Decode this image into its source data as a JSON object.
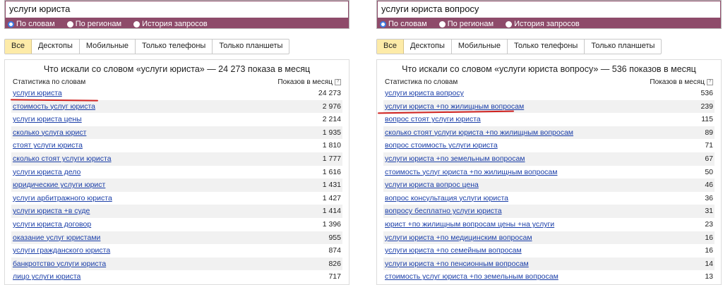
{
  "left": {
    "query": "услуги юриста",
    "radios": [
      {
        "label": "По словам",
        "checked": true
      },
      {
        "label": "По регионам",
        "checked": false
      },
      {
        "label": "История запросов",
        "checked": false
      }
    ],
    "tabs": [
      {
        "label": "Все",
        "active": true
      },
      {
        "label": "Десктопы",
        "active": false
      },
      {
        "label": "Мобильные",
        "active": false
      },
      {
        "label": "Только телефоны",
        "active": false
      },
      {
        "label": "Только планшеты",
        "active": false
      }
    ],
    "title": "Что искали со словом «услуги юриста» — 24 273 показа в месяц",
    "col_left": "Статистика по словам",
    "col_right": "Показов в месяц",
    "help": "?",
    "rows": [
      {
        "phrase": "услуги юриста",
        "count": "24 273"
      },
      {
        "phrase": "стоимость услуг юриста",
        "count": "2 976"
      },
      {
        "phrase": "услуги юриста цены",
        "count": "2 214"
      },
      {
        "phrase": "сколько услуга юрист",
        "count": "1 935"
      },
      {
        "phrase": "стоят услуги юриста",
        "count": "1 810"
      },
      {
        "phrase": "сколько стоят услуги юриста",
        "count": "1 777"
      },
      {
        "phrase": "услуги юриста дело",
        "count": "1 616"
      },
      {
        "phrase": "юридические услуги юрист",
        "count": "1 431"
      },
      {
        "phrase": "услуги арбитражного юриста",
        "count": "1 427"
      },
      {
        "phrase": "услуги юриста +в суде",
        "count": "1 414"
      },
      {
        "phrase": "услуги юриста договор",
        "count": "1 396"
      },
      {
        "phrase": "оказание услуг юристами",
        "count": "955"
      },
      {
        "phrase": "услуги гражданского юриста",
        "count": "874"
      },
      {
        "phrase": "банкротство услуги юриста",
        "count": "826"
      },
      {
        "phrase": "лицо услуги юриста",
        "count": "717"
      }
    ]
  },
  "right": {
    "query": "услуги юриста вопросу",
    "radios": [
      {
        "label": "По словам",
        "checked": true
      },
      {
        "label": "По регионам",
        "checked": false
      },
      {
        "label": "История запросов",
        "checked": false
      }
    ],
    "tabs": [
      {
        "label": "Все",
        "active": true
      },
      {
        "label": "Десктопы",
        "active": false
      },
      {
        "label": "Мобильные",
        "active": false
      },
      {
        "label": "Только телефоны",
        "active": false
      },
      {
        "label": "Только планшеты",
        "active": false
      }
    ],
    "title": "Что искали со словом «услуги юриста вопросу» — 536 показов в месяц",
    "col_left": "Статистика по словам",
    "col_right": "Показов в месяц",
    "help": "?",
    "rows": [
      {
        "phrase": "услуги юриста вопросу",
        "count": "536"
      },
      {
        "phrase": "услуги юриста +по жилищным вопросам",
        "count": "239"
      },
      {
        "phrase": "вопрос стоят услуги юриста",
        "count": "115"
      },
      {
        "phrase": "сколько стоят услуги юриста +по жилищным вопросам",
        "count": "89"
      },
      {
        "phrase": "вопрос стоимость услуги юриста",
        "count": "71"
      },
      {
        "phrase": "услуги юриста +по земельным вопросам",
        "count": "67"
      },
      {
        "phrase": "стоимость услуг юриста +по жилищным вопросам",
        "count": "50"
      },
      {
        "phrase": "услуги юриста вопрос цена",
        "count": "46"
      },
      {
        "phrase": "вопрос консультация услуги юриста",
        "count": "36"
      },
      {
        "phrase": "вопросу бесплатно услуги юриста",
        "count": "31"
      },
      {
        "phrase": "юрист +по жилищным вопросам цены +на услуги",
        "count": "23"
      },
      {
        "phrase": "услуги юриста +по медицинским вопросам",
        "count": "16"
      },
      {
        "phrase": "услуги юриста +по семейным вопросам",
        "count": "16"
      },
      {
        "phrase": "услуги юриста +по пенсионным вопросам",
        "count": "14"
      },
      {
        "phrase": "стоимость услуг юриста +по земельным вопросам",
        "count": "13"
      }
    ]
  },
  "colors": {
    "header_bar": "#8e4b6a",
    "link": "#1a3ea8",
    "active_tab": "#fdeba8",
    "highlight_line": "#d0221f"
  }
}
